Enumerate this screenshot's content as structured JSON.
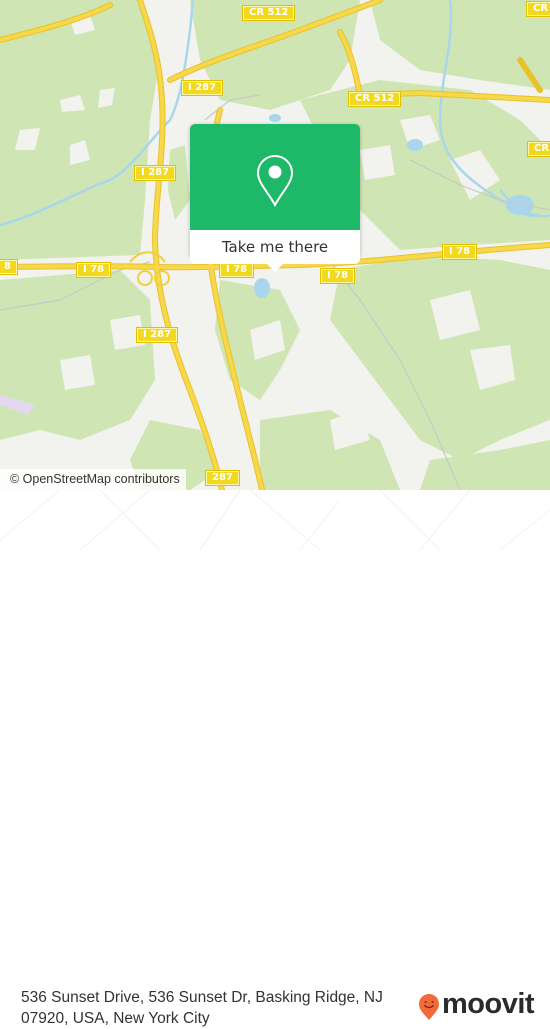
{
  "map": {
    "colors": {
      "land": "#f2f2ef",
      "forest": "#cfe6b4",
      "water": "#a9d6ec",
      "highway": "#f6d84a",
      "highway_edge": "#e8c22a",
      "shield": "#f3d820",
      "local_road": "#bdbdbd"
    },
    "road_shields": [
      {
        "id": "cr512-top",
        "label": "CR 512"
      },
      {
        "id": "cr512-mid",
        "label": "CR 512"
      },
      {
        "id": "cr-right-top",
        "label": "CR"
      },
      {
        "id": "cr-right-mid",
        "label": "CR"
      },
      {
        "id": "i287-upper",
        "label": "I 287"
      },
      {
        "id": "i287-middle",
        "label": "I 287"
      },
      {
        "id": "i287-lower",
        "label": "I 287"
      },
      {
        "id": "i287-bottom",
        "label": "287"
      },
      {
        "id": "i78-left-edge",
        "label": "8"
      },
      {
        "id": "i78-west",
        "label": "I 78"
      },
      {
        "id": "i78-center",
        "label": "I 78"
      },
      {
        "id": "i78-east",
        "label": "I 78"
      },
      {
        "id": "i78-far-east",
        "label": "I 78"
      }
    ],
    "attribution": "© OpenStreetMap contributors"
  },
  "popup": {
    "icon": "map-pin-icon",
    "accent": "#1db868",
    "button_label": "Take me there"
  },
  "footer": {
    "address": "536 Sunset Drive, 536 Sunset Dr, Basking Ridge, NJ 07920, USA, New York City",
    "logo": {
      "icon": "moovit-smile-pin-icon",
      "text": "moovit",
      "icon_color": "#f26a3b"
    }
  }
}
